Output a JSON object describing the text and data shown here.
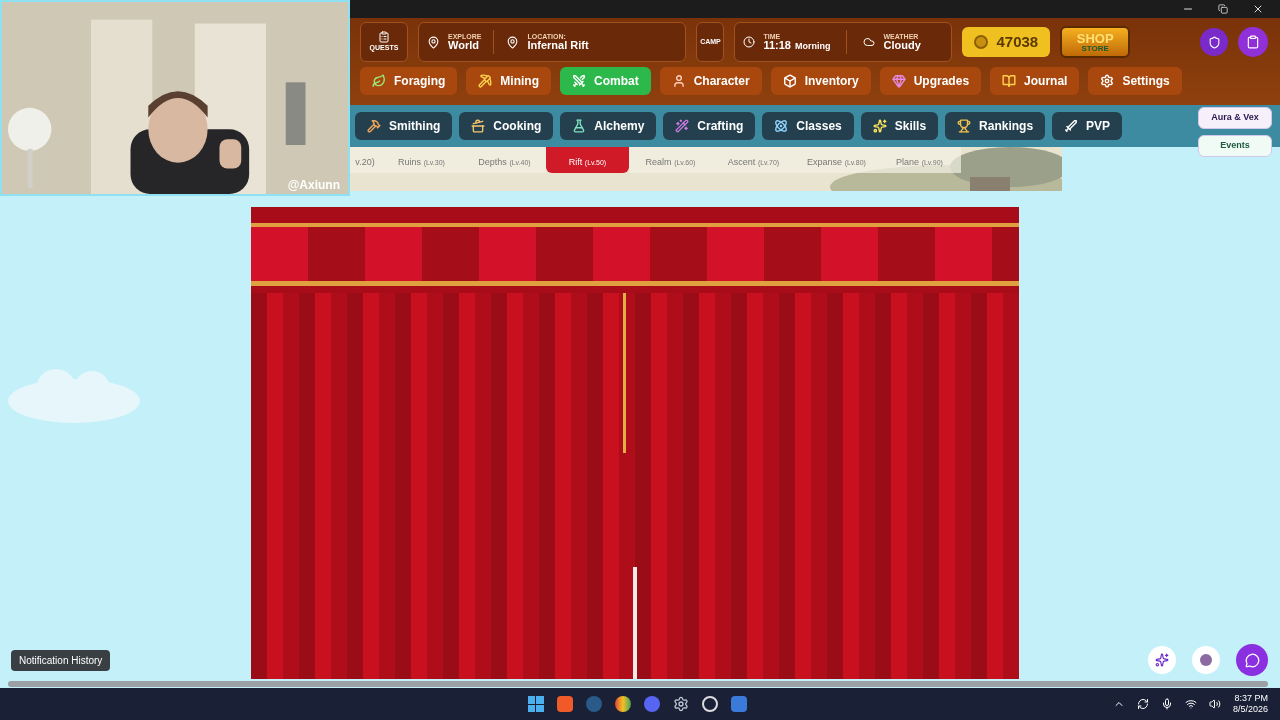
{
  "stream_overlay": {
    "handle": "@Axiunn"
  },
  "header": {
    "quests": "QUESTS",
    "explore": {
      "label": "EXPLORE",
      "value": "World"
    },
    "location": {
      "label": "LOCATION:",
      "value": "Infernal Rift"
    },
    "camp": "CAMP",
    "time": {
      "label": "TIME",
      "value": "11:18",
      "period": "Morning"
    },
    "weather": {
      "label": "WEATHER",
      "value": "Cloudy"
    },
    "gold": "47038",
    "shop": {
      "title": "SHOP",
      "subtitle": "STORE"
    }
  },
  "nav_primary": [
    {
      "label": "Foraging",
      "selected": false
    },
    {
      "label": "Mining",
      "selected": false
    },
    {
      "label": "Combat",
      "selected": true
    },
    {
      "label": "Character",
      "selected": false
    },
    {
      "label": "Inventory",
      "selected": false
    },
    {
      "label": "Upgrades",
      "selected": false
    },
    {
      "label": "Journal",
      "selected": false
    },
    {
      "label": "Settings",
      "selected": false
    }
  ],
  "nav_secondary": [
    "Smithing",
    "Cooking",
    "Alchemy",
    "Crafting",
    "Classes",
    "Skills",
    "Rankings",
    "PVP"
  ],
  "side_buttons": [
    "Aura & Vex",
    "Events"
  ],
  "zones": [
    {
      "label": "v.20)",
      "selected": false
    },
    {
      "label": "Ruins",
      "level": "(Lv.30)",
      "selected": false
    },
    {
      "label": "Depths",
      "level": "(Lv.40)",
      "selected": false
    },
    {
      "label": "Rift",
      "level": "(Lv.50)",
      "selected": true
    },
    {
      "label": "Realm",
      "level": "(Lv.60)",
      "selected": false
    },
    {
      "label": "Ascent",
      "level": "(Lv.70)",
      "selected": false
    },
    {
      "label": "Expanse",
      "level": "(Lv.80)",
      "selected": false
    },
    {
      "label": "Plane",
      "level": "(Lv.90)",
      "selected": false
    }
  ],
  "notification_tooltip": "Notification History",
  "taskbar": {
    "time": "8:37 PM",
    "date": "8/5/2026"
  }
}
